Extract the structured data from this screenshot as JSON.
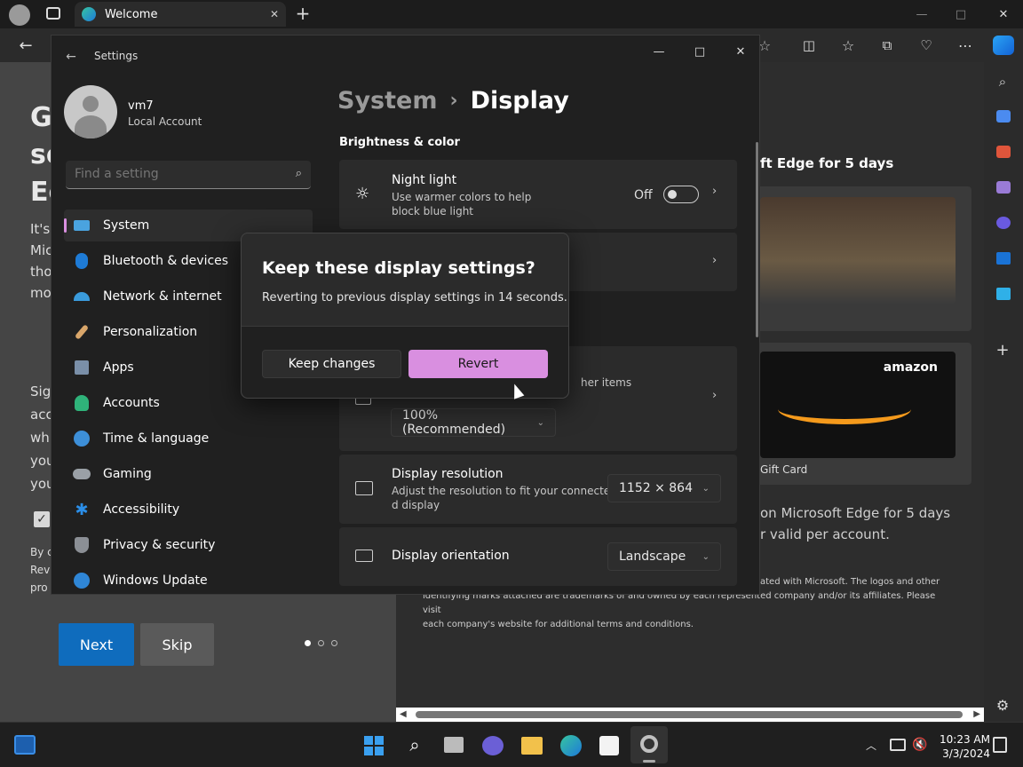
{
  "browser": {
    "tab_title": "Welcome",
    "window_controls": {
      "minimize": "—",
      "maximize": "□",
      "close": "✕"
    }
  },
  "edge_page": {
    "left_heading_fragments": [
      "G",
      "se",
      "Ec"
    ],
    "left_body_fragments": [
      "It's",
      "Mic",
      "tho",
      "mo"
    ],
    "left_body2_fragments": [
      "Sig",
      "acc",
      "whi",
      "you",
      "you"
    ],
    "left_fine_fragments": [
      "By c",
      "Rev",
      "pro"
    ],
    "next_label": "Next",
    "skip_label": "Skip",
    "promo_title": "ft Edge for 5 days",
    "gift_card_label": "Gift Card",
    "amazon_logo": "amazon",
    "offer_line1": "on Microsoft Edge for 5 days",
    "offer_line2": "r valid per account.",
    "disclaimer_line1": "ated with Microsoft. The logos and other",
    "disclaimer_line2": "identifying marks attached are trademarks of and owned by each represented company and/or its affiliates. Please visit",
    "disclaimer_line3": "each company's website for additional terms and conditions."
  },
  "settings": {
    "window_title": "Settings",
    "user_name": "vm7",
    "account_type": "Local Account",
    "search_placeholder": "Find a setting",
    "breadcrumb_parent": "System",
    "breadcrumb_sep": "›",
    "breadcrumb_current": "Display",
    "section_brightness": "Brightness & color",
    "night_light": {
      "title": "Night light",
      "desc1": "Use warmer colors to help",
      "desc2": "block blue light",
      "state": "Off"
    },
    "scale_desc_fragment": "her items",
    "scale_value": "100% (Recommended)",
    "resolution": {
      "title": "Display resolution",
      "desc1": "Adjust the resolution to fit your connecte",
      "desc2": "d display",
      "value": "1152 × 864"
    },
    "orientation": {
      "title": "Display orientation",
      "value": "Landscape"
    },
    "nav": [
      {
        "label": "System",
        "icon": "monitor-icon",
        "color": "#4aa3df"
      },
      {
        "label": "Bluetooth & devices",
        "icon": "bluetooth-icon",
        "color": "#1e7bd6"
      },
      {
        "label": "Network & internet",
        "icon": "wifi-icon",
        "color": "#3a9bdc"
      },
      {
        "label": "Personalization",
        "icon": "brush-icon",
        "color": "#d9a66a"
      },
      {
        "label": "Apps",
        "icon": "apps-icon",
        "color": "#7a8fa8"
      },
      {
        "label": "Accounts",
        "icon": "person-icon",
        "color": "#2fb37a"
      },
      {
        "label": "Time & language",
        "icon": "globe-clock-icon",
        "color": "#3d8fd8"
      },
      {
        "label": "Gaming",
        "icon": "gamepad-icon",
        "color": "#9aa0a6"
      },
      {
        "label": "Accessibility",
        "icon": "accessibility-icon",
        "color": "#2b8ee8"
      },
      {
        "label": "Privacy & security",
        "icon": "shield-icon",
        "color": "#8b8f95"
      },
      {
        "label": "Windows Update",
        "icon": "update-icon",
        "color": "#2f86d6"
      }
    ]
  },
  "dialog": {
    "title": "Keep these display settings?",
    "message": "Reverting to previous display settings in 14 seconds.",
    "keep_label": "Keep changes",
    "revert_label": "Revert",
    "accent": "#d98fe0"
  },
  "taskbar": {
    "time": "10:23 AM",
    "date": "3/3/2024"
  }
}
